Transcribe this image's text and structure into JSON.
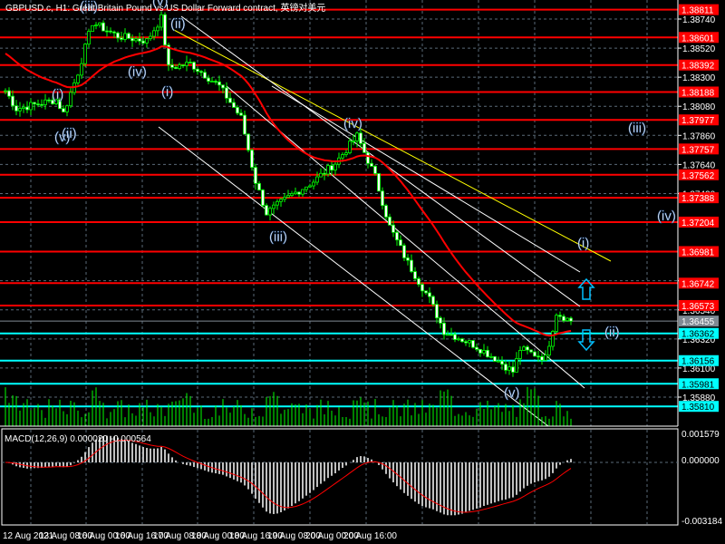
{
  "header": {
    "title": "GBPUSD.c, H1:  Great Britain Pound vs US Dollar Forward contract, 英镑对美元"
  },
  "indicator": {
    "label": "MACD(12,26,9) 0.000020 -0.000564",
    "max_label": "0.001579",
    "zero_label": "0.000000",
    "min_label": "-0.003184"
  },
  "colors": {
    "bull": "#00ff00",
    "ma": "#ff0000",
    "resistance": "#ff0000",
    "support": "#00ffff",
    "trend": "#ffff00",
    "current": "#808a94"
  },
  "chart_data": {
    "type": "candlestick",
    "symbol": "GBPUSD.c",
    "timeframe": "H1",
    "ylim": [
      1.356,
      1.3888
    ],
    "price_ticks": [
      "1.38740",
      "1.38520",
      "1.38300",
      "1.38080",
      "1.37860",
      "1.37640",
      "1.37420",
      "1.36760",
      "1.36540",
      "1.36320",
      "1.36100",
      "1.35880"
    ],
    "resistance_levels": [
      "1.38811",
      "1.38601",
      "1.38392",
      "1.38188",
      "1.37977",
      "1.37757",
      "1.37562",
      "1.37388",
      "1.37204",
      "1.36981",
      "1.36742",
      "1.36573"
    ],
    "support_levels": [
      "1.36362",
      "1.36156",
      "1.35981",
      "1.35810"
    ],
    "current_price": "1.36455",
    "time_labels": [
      "12 Aug 2021",
      "13 Aug 08:00",
      "16 Aug 00:00",
      "16 Aug 16:00",
      "17 Aug 08:00",
      "18 Aug 00:00",
      "18 Aug 16:00",
      "19 Aug 08:00",
      "20 Aug 00:00",
      "20 Aug 16:00"
    ],
    "close_waypoints": [
      [
        0,
        1.38198
      ],
      [
        3,
        1.38061
      ],
      [
        14,
        1.3813
      ],
      [
        16,
        1.38027
      ],
      [
        20,
        1.38335
      ],
      [
        24,
        1.38713
      ],
      [
        31,
        1.3861
      ],
      [
        39,
        1.38575
      ],
      [
        43,
        1.38747
      ],
      [
        45,
        1.3837
      ],
      [
        51,
        1.38404
      ],
      [
        59,
        1.38232
      ],
      [
        65,
        1.37992
      ],
      [
        69,
        1.37512
      ],
      [
        72,
        1.37272
      ],
      [
        79,
        1.3741
      ],
      [
        85,
        1.37512
      ],
      [
        91,
        1.3765
      ],
      [
        97,
        1.37855
      ],
      [
        102,
        1.37547
      ],
      [
        106,
        1.37169
      ],
      [
        111,
        1.36895
      ],
      [
        117,
        1.36621
      ],
      [
        121,
        1.3638
      ],
      [
        129,
        1.36278
      ],
      [
        135,
        1.36175
      ],
      [
        140,
        1.36072
      ],
      [
        142,
        1.36243
      ],
      [
        149,
        1.36175
      ],
      [
        152,
        1.36518
      ],
      [
        156,
        1.36455
      ]
    ],
    "wave_labels": [
      "(iii)",
      "(v)",
      "(ii)",
      "(iv)",
      "(i)",
      "(i)",
      "(v)",
      "(ii)",
      "(iii)",
      "(iv)",
      "(v)",
      "(i)",
      "(ii)",
      "(iii)",
      "(iv)"
    ]
  }
}
